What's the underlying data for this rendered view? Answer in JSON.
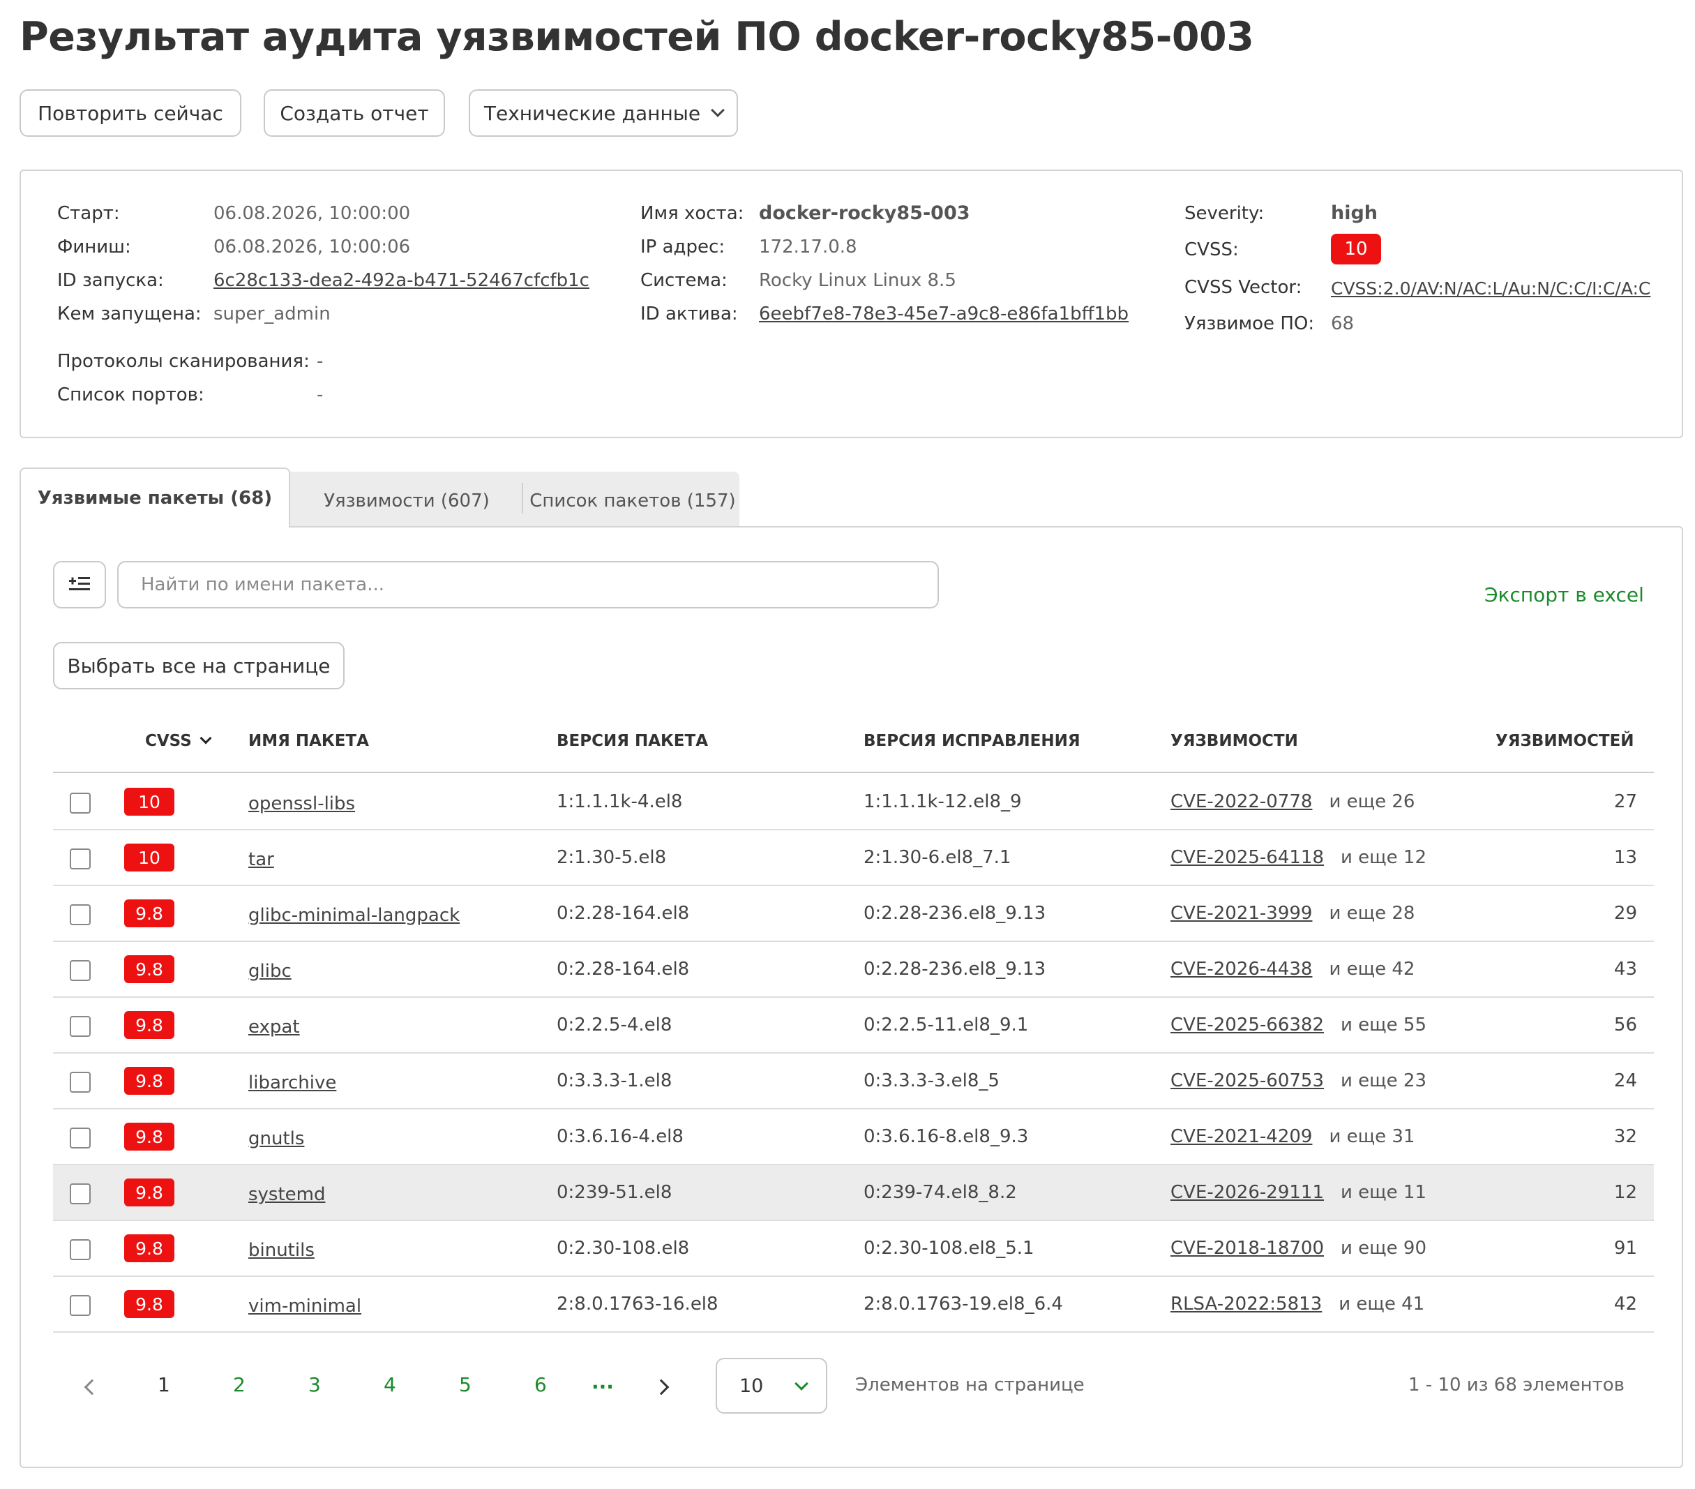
{
  "title": "Результат аудита уязвимостей ПО docker-rocky85-003",
  "buttons": {
    "retry": "Повторить сейчас",
    "report": "Создать отчет",
    "tech": "Технические данные"
  },
  "info": {
    "start_label": "Старт:",
    "start_value": "06.08.2026, 10:00:00",
    "finish_label": "Финиш:",
    "finish_value": "06.08.2026, 10:00:06",
    "run_id_label": "ID запуска:",
    "run_id_value": "6c28c133-dea2-492a-b471-52467cfcfb1c",
    "launched_by_label": "Кем запущена:",
    "launched_by_value": "super_admin",
    "protocols_label": "Протоколы сканирования:",
    "protocols_value": "-",
    "ports_label": "Список портов:",
    "ports_value": "-",
    "hostname_label": "Имя хоста:",
    "hostname_value": "docker-rocky85-003",
    "ip_label": "IP адрес:",
    "ip_value": "172.17.0.8",
    "system_label": "Система:",
    "system_value": "Rocky Linux Linux 8.5",
    "asset_id_label": "ID актива:",
    "asset_id_value": "6eebf7e8-78e3-45e7-a9c8-e86fa1bff1bb",
    "severity_label": "Severity:",
    "severity_value": "high",
    "cvss_label": "CVSS:",
    "cvss_value": "10",
    "cvss_vector_label": "CVSS Vector:",
    "cvss_vector_value": "CVSS:2.0/AV:N/AC:L/Au:N/C:C/I:C/A:C",
    "vuln_sw_label": "Уязвимое ПО:",
    "vuln_sw_value": "68"
  },
  "tabs": [
    {
      "label": "Уязвимые пакеты (68)"
    },
    {
      "label": "Уязвимости (607)"
    },
    {
      "label": "Список пакетов (157)"
    }
  ],
  "toolbar": {
    "search_placeholder": "Найти по имени пакета...",
    "export_label": "Экспорт в excel",
    "select_all_label": "Выбрать все на странице"
  },
  "table": {
    "headers": {
      "cvss": "CVSS",
      "name": "ИМЯ ПАКЕТА",
      "version": "ВЕРСИЯ ПАКЕТА",
      "fix_version": "ВЕРСИЯ ИСПРАВЛЕНИЯ",
      "vulns": "УЯЗВИМОСТИ",
      "count": "УЯЗВИМОСТЕЙ"
    },
    "rows": [
      {
        "cvss": "10",
        "name": "openssl-libs",
        "version": "1:1.1.1k-4.el8",
        "fix": "1:1.1.1k-12.el8_9",
        "cve": "CVE-2022-0778",
        "more": "и еще 26",
        "count": "27"
      },
      {
        "cvss": "10",
        "name": "tar",
        "version": "2:1.30-5.el8",
        "fix": "2:1.30-6.el8_7.1",
        "cve": "CVE-2025-64118",
        "more": "и еще 12",
        "count": "13"
      },
      {
        "cvss": "9.8",
        "name": "glibc-minimal-langpack",
        "version": "0:2.28-164.el8",
        "fix": "0:2.28-236.el8_9.13",
        "cve": "CVE-2021-3999",
        "more": "и еще 28",
        "count": "29"
      },
      {
        "cvss": "9.8",
        "name": "glibc",
        "version": "0:2.28-164.el8",
        "fix": "0:2.28-236.el8_9.13",
        "cve": "CVE-2026-4438",
        "more": "и еще 42",
        "count": "43"
      },
      {
        "cvss": "9.8",
        "name": "expat",
        "version": "0:2.2.5-4.el8",
        "fix": "0:2.2.5-11.el8_9.1",
        "cve": "CVE-2025-66382",
        "more": "и еще 55",
        "count": "56"
      },
      {
        "cvss": "9.8",
        "name": "libarchive",
        "version": "0:3.3.3-1.el8",
        "fix": "0:3.3.3-3.el8_5",
        "cve": "CVE-2025-60753",
        "more": "и еще 23",
        "count": "24"
      },
      {
        "cvss": "9.8",
        "name": "gnutls",
        "version": "0:3.6.16-4.el8",
        "fix": "0:3.6.16-8.el8_9.3",
        "cve": "CVE-2021-4209",
        "more": "и еще 31",
        "count": "32"
      },
      {
        "cvss": "9.8",
        "name": "systemd",
        "version": "0:239-51.el8",
        "fix": "0:239-74.el8_8.2",
        "cve": "CVE-2026-29111",
        "more": "и еще 11",
        "count": "12"
      },
      {
        "cvss": "9.8",
        "name": "binutils",
        "version": "0:2.30-108.el8",
        "fix": "0:2.30-108.el8_5.1",
        "cve": "CVE-2018-18700",
        "more": "и еще 90",
        "count": "91"
      },
      {
        "cvss": "9.8",
        "name": "vim-minimal",
        "version": "2:8.0.1763-16.el8",
        "fix": "2:8.0.1763-19.el8_6.4",
        "cve": "RLSA-2022:5813",
        "more": "и еще 41",
        "count": "42"
      }
    ]
  },
  "pagination": {
    "pages": [
      "1",
      "2",
      "3",
      "4",
      "5",
      "6"
    ],
    "ellipsis": "...",
    "per_page": "10",
    "per_page_label": "Элементов на странице",
    "summary": "1 - 10 из 68 элементов"
  },
  "colors": {
    "badge_red": "#ee1111",
    "accent_green": "#1a8a2a",
    "hover_row": "#ececec"
  }
}
